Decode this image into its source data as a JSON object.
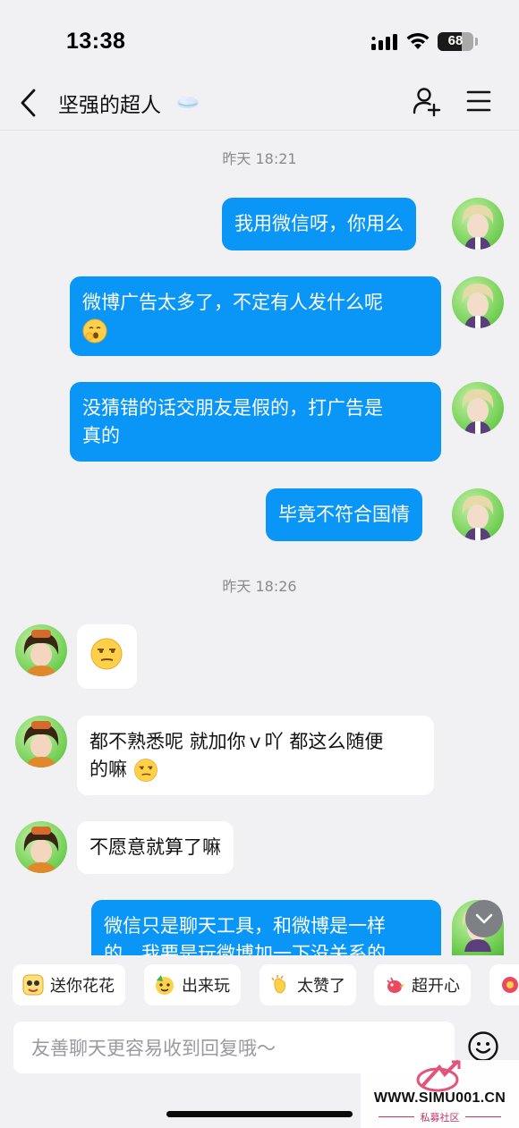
{
  "status_bar": {
    "time": "13:38",
    "battery": "68",
    "battery_level": 0.68
  },
  "header": {
    "title": "坚强的超人"
  },
  "timestamps": [
    "昨天 18:21",
    "昨天 18:26"
  ],
  "messages": [
    {
      "from": "me",
      "text": "我用微信呀，你用么"
    },
    {
      "from": "me",
      "text": "微博广告太多了，不定有人发什么呢"
    },
    {
      "from": "me",
      "text": "没猜错的话交朋友是假的，打广告是",
      "text2": "真的"
    },
    {
      "from": "me",
      "text": "毕竟不符合国情"
    },
    {
      "from": "peer",
      "text": ""
    },
    {
      "from": "peer",
      "text": "都不熟悉呢 就加你ｖ吖 都这么随便",
      "text2": "的嘛"
    },
    {
      "from": "peer",
      "text": "不愿意就算了嘛"
    },
    {
      "from": "me",
      "text": "微信只是聊天工具，和微博是一样",
      "text2": "的，我要是玩微博加一下没关系的"
    }
  ],
  "quick_replies": [
    "送你花花",
    "出来玩",
    "太赞了",
    "超开心"
  ],
  "composer": {
    "placeholder": "友善聊天更容易收到回复哦～"
  },
  "watermark": {
    "url": "WWW.SIMU001.CN",
    "sub": "私募社区"
  },
  "colors": {
    "bubble_out": "#0a96f6",
    "bubble_in": "#ffffff",
    "background": "#f1f1f3"
  }
}
